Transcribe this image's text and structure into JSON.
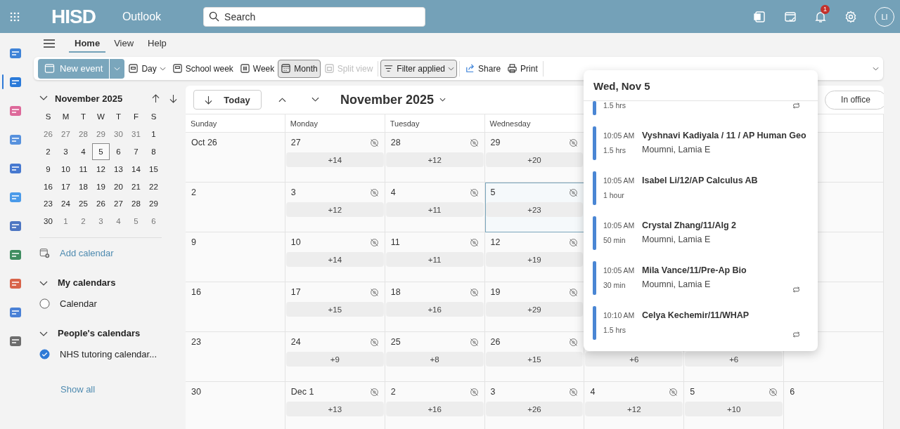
{
  "top_bar": {
    "logo": "HISD",
    "app_name": "Outlook",
    "search": {
      "placeholder": "Search"
    },
    "notifications_badge": "1",
    "avatar": "LI"
  },
  "rail": [
    {
      "selected": false
    },
    {
      "selected": true
    },
    {
      "selected": false
    },
    {
      "selected": false
    },
    {
      "selected": false
    },
    {
      "selected": false
    },
    {
      "selected": false
    },
    {
      "selected": false
    },
    {
      "selected": false
    },
    {
      "selected": false
    },
    {
      "selected": false
    }
  ],
  "ribbon_tabs": [
    {
      "label": "Home",
      "selected": true
    },
    {
      "label": "View",
      "selected": false
    },
    {
      "label": "Help",
      "selected": false
    }
  ],
  "toolbar": {
    "new_event": "New event",
    "views": [
      {
        "label": "Day",
        "kind": "dropdown",
        "selected": false,
        "disabled": false
      },
      {
        "label": "School week",
        "kind": "button",
        "selected": false,
        "disabled": false
      },
      {
        "label": "Week",
        "kind": "button",
        "selected": false,
        "disabled": false
      },
      {
        "label": "Month",
        "kind": "button",
        "selected": true,
        "disabled": false
      },
      {
        "label": "Split view",
        "kind": "button",
        "selected": false,
        "disabled": true
      }
    ],
    "filter": "Filter applied",
    "actions": [
      "Share",
      "Print"
    ]
  },
  "mini_calendar": {
    "title": "November 2025",
    "weekdays": [
      "S",
      "M",
      "T",
      "W",
      "T",
      "F",
      "S"
    ],
    "weeks": [
      [
        {
          "d": "26",
          "outside": true,
          "selected": false
        },
        {
          "d": "27",
          "outside": true,
          "selected": false
        },
        {
          "d": "28",
          "outside": true,
          "selected": false
        },
        {
          "d": "29",
          "outside": true,
          "selected": false
        },
        {
          "d": "30",
          "outside": true,
          "selected": false
        },
        {
          "d": "31",
          "outside": true,
          "selected": false
        },
        {
          "d": "1",
          "outside": false,
          "selected": false
        }
      ],
      [
        {
          "d": "2",
          "outside": false,
          "selected": false
        },
        {
          "d": "3",
          "outside": false,
          "selected": false
        },
        {
          "d": "4",
          "outside": false,
          "selected": false
        },
        {
          "d": "5",
          "outside": false,
          "selected": true
        },
        {
          "d": "6",
          "outside": false,
          "selected": false
        },
        {
          "d": "7",
          "outside": false,
          "selected": false
        },
        {
          "d": "8",
          "outside": false,
          "selected": false
        }
      ],
      [
        {
          "d": "9",
          "outside": false,
          "selected": false
        },
        {
          "d": "10",
          "outside": false,
          "selected": false
        },
        {
          "d": "11",
          "outside": false,
          "selected": false
        },
        {
          "d": "12",
          "outside": false,
          "selected": false
        },
        {
          "d": "13",
          "outside": false,
          "selected": false
        },
        {
          "d": "14",
          "outside": false,
          "selected": false
        },
        {
          "d": "15",
          "outside": false,
          "selected": false
        }
      ],
      [
        {
          "d": "16",
          "outside": false,
          "selected": false
        },
        {
          "d": "17",
          "outside": false,
          "selected": false
        },
        {
          "d": "18",
          "outside": false,
          "selected": false
        },
        {
          "d": "19",
          "outside": false,
          "selected": false
        },
        {
          "d": "20",
          "outside": false,
          "selected": false
        },
        {
          "d": "21",
          "outside": false,
          "selected": false
        },
        {
          "d": "22",
          "outside": false,
          "selected": false
        }
      ],
      [
        {
          "d": "23",
          "outside": false,
          "selected": false
        },
        {
          "d": "24",
          "outside": false,
          "selected": false
        },
        {
          "d": "25",
          "outside": false,
          "selected": false
        },
        {
          "d": "26",
          "outside": false,
          "selected": false
        },
        {
          "d": "27",
          "outside": false,
          "selected": false
        },
        {
          "d": "28",
          "outside": false,
          "selected": false
        },
        {
          "d": "29",
          "outside": false,
          "selected": false
        }
      ],
      [
        {
          "d": "30",
          "outside": false,
          "selected": false
        },
        {
          "d": "1",
          "outside": true,
          "selected": false
        },
        {
          "d": "2",
          "outside": true,
          "selected": false
        },
        {
          "d": "3",
          "outside": true,
          "selected": false
        },
        {
          "d": "4",
          "outside": true,
          "selected": false
        },
        {
          "d": "5",
          "outside": true,
          "selected": false
        },
        {
          "d": "6",
          "outside": true,
          "selected": false
        }
      ]
    ]
  },
  "sidebar": {
    "add_calendar": "Add calendar",
    "groups": [
      {
        "title": "My calendars",
        "expanded": true,
        "calendars": [
          {
            "name": "Calendar",
            "checked": false
          }
        ]
      },
      {
        "title": "People's calendars",
        "expanded": true,
        "calendars": [
          {
            "name": "NHS tutoring calendar...",
            "checked": true
          }
        ]
      }
    ],
    "show_all": "Show all"
  },
  "month_view": {
    "today_button": "Today",
    "title": "November 2025",
    "in_office": "In office",
    "weekdays": [
      "Sunday",
      "Monday",
      "Tuesday",
      "Wednesday"
    ],
    "weeks": [
      {
        "sun": {
          "date": "Oct 26",
          "selected": false
        },
        "mon": {
          "date": "27",
          "more": "+14",
          "flag": true,
          "selected": false
        },
        "tue": {
          "date": "28",
          "more": "+12",
          "flag": true,
          "selected": false
        },
        "wed": {
          "date": "29",
          "more": "+20",
          "flag": true,
          "selected": false
        },
        "sat": {
          "selected": false
        }
      },
      {
        "sun": {
          "date": "2",
          "selected": false
        },
        "mon": {
          "date": "3",
          "more": "+12",
          "flag": true,
          "selected": false
        },
        "tue": {
          "date": "4",
          "more": "+11",
          "flag": true,
          "selected": false
        },
        "wed": {
          "date": "5",
          "more": "+23",
          "flag": true,
          "selected": true
        },
        "sat": {
          "selected": false
        }
      },
      {
        "sun": {
          "date": "9",
          "selected": false
        },
        "mon": {
          "date": "10",
          "more": "+14",
          "flag": true,
          "selected": false
        },
        "tue": {
          "date": "11",
          "more": "+11",
          "flag": true,
          "selected": false
        },
        "wed": {
          "date": "12",
          "more": "+19",
          "flag": true,
          "selected": false
        },
        "sat": {
          "selected": false
        }
      },
      {
        "sun": {
          "date": "16",
          "selected": false
        },
        "mon": {
          "date": "17",
          "more": "+15",
          "flag": true,
          "selected": false
        },
        "tue": {
          "date": "18",
          "more": "+16",
          "flag": true,
          "selected": false
        },
        "wed": {
          "date": "19",
          "more": "+29",
          "flag": true,
          "selected": false
        },
        "sat": {
          "selected": false
        }
      },
      {
        "sun": {
          "date": "23",
          "selected": false
        },
        "mon": {
          "date": "24",
          "more": "+9",
          "flag": true,
          "selected": false
        },
        "tue": {
          "date": "25",
          "more": "+8",
          "flag": true,
          "selected": false
        },
        "wed": {
          "date": "26",
          "more": "+15",
          "flag": true,
          "selected": false
        },
        "thu": {
          "more": "+6",
          "selected": false
        },
        "fri": {
          "more": "+6",
          "selected": false
        },
        "sat": {
          "selected": false
        }
      },
      {
        "sun": {
          "date": "30",
          "selected": false
        },
        "mon": {
          "date": "Dec 1",
          "more": "+13",
          "flag": true,
          "selected": false
        },
        "tue": {
          "date": "2",
          "more": "+16",
          "flag": true,
          "selected": false
        },
        "wed": {
          "date": "3",
          "more": "+26",
          "flag": true,
          "selected": false
        },
        "thu": {
          "date": "4",
          "more": "+12",
          "flag": true,
          "selected": false
        },
        "fri": {
          "date": "5",
          "more": "+10",
          "flag": true,
          "selected": false
        },
        "sat": {
          "date": "6",
          "selected": false
        }
      }
    ]
  },
  "popup": {
    "title": "Wed, Nov 5",
    "events": [
      {
        "duration": "1.5 hrs",
        "recurring": true
      },
      {
        "time": "10:05 AM",
        "title": "Vyshnavi Kadiyala / 11 / AP Human Geo",
        "duration": "1.5 hrs",
        "organizer": "Moumni, Lamia E",
        "recurring": false
      },
      {
        "time": "10:05 AM",
        "title": "Isabel Li/12/AP Calculus AB",
        "duration": "1 hour",
        "recurring": false
      },
      {
        "time": "10:05 AM",
        "title": "Crystal Zhang/11/Alg 2",
        "duration": "50 min",
        "organizer": "Moumni, Lamia E",
        "recurring": false
      },
      {
        "time": "10:05 AM",
        "title": "Mila Vance/11/Pre-Ap Bio",
        "duration": "30 min",
        "organizer": "Moumni, Lamia E",
        "recurring": true
      },
      {
        "time": "10:10 AM",
        "title": "Celya Kechemir/11/WHAP",
        "duration": "1.5 hrs",
        "recurring": true
      }
    ]
  }
}
